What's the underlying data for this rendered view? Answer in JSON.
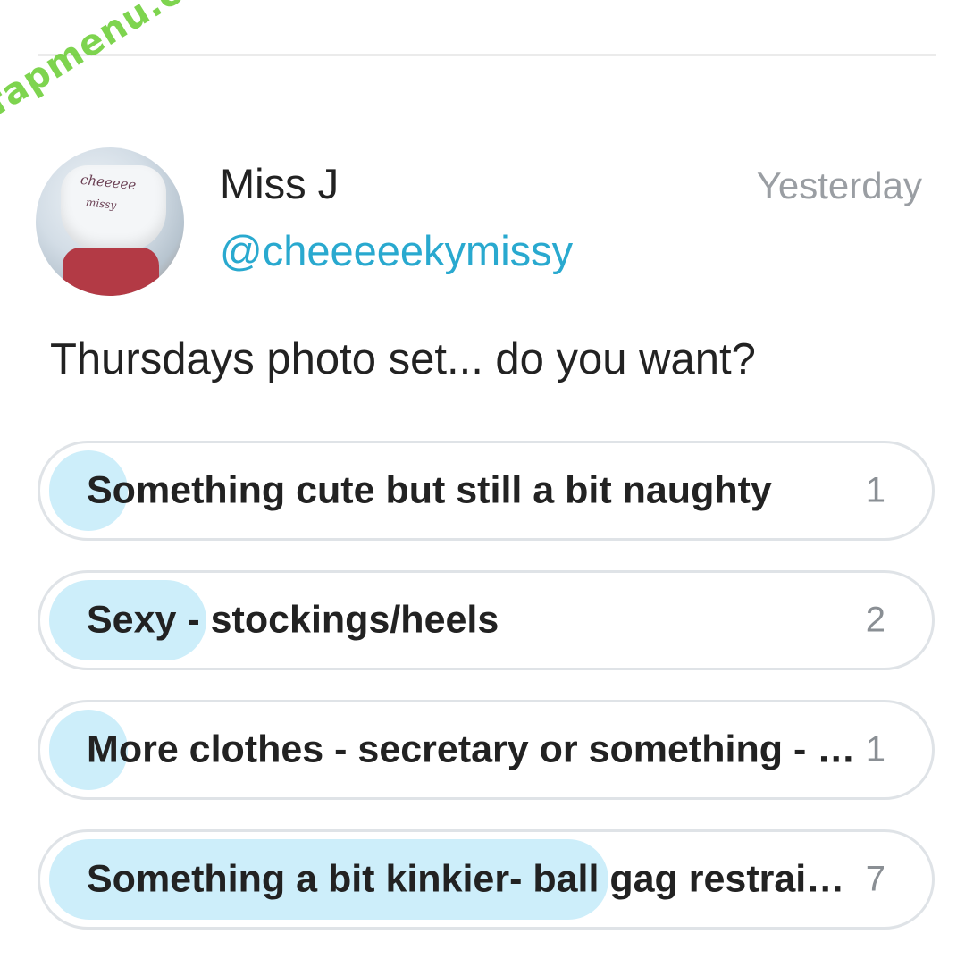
{
  "watermark": "fapmenu.com",
  "post": {
    "author_name": "Miss J",
    "handle": "@cheeeeekymissy",
    "time": "Yesterday",
    "avatar_text_line1": "cheeeee",
    "avatar_text_line2": "missy",
    "text": "Thursdays photo set... do you want?"
  },
  "poll": {
    "options": [
      {
        "label": "Something cute but still a bit naughty",
        "count": "1",
        "share": 0.09
      },
      {
        "label": "Sexy - stockings/heels",
        "count": "2",
        "share": 0.18
      },
      {
        "label": "More clothes - secretary or something - something",
        "count": "1",
        "share": 0.09
      },
      {
        "label": "Something a bit kinkier- ball gag restraints",
        "count": "7",
        "share": 0.64
      }
    ]
  },
  "colors": {
    "handle": "#29a9cf",
    "poll_fill": "#cdeefa",
    "watermark": "#5ac81e"
  }
}
